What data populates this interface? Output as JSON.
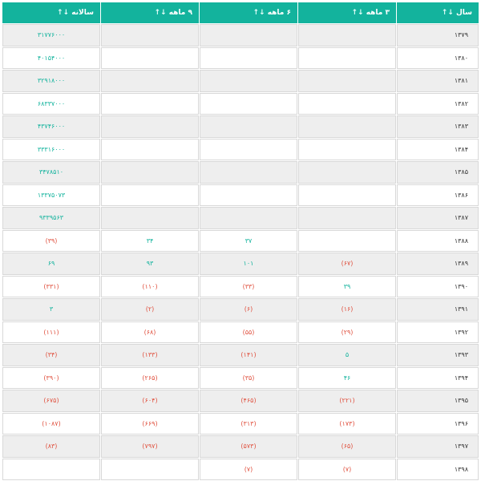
{
  "headers": {
    "year": "سال",
    "q3": "۳ ماهه",
    "q6": "۶ ماهه",
    "q9": "۹ ماهه",
    "annual": "سالانه"
  },
  "sort_icon": "↓↑",
  "colors": {
    "header": "#13b39d",
    "positive": "#13b39d",
    "negative": "#e0513f"
  },
  "rows": [
    {
      "year": "۱۳۷۹",
      "q3": "",
      "q6": "",
      "q9": "",
      "annual": "۳۱۷۷۶۰۰۰"
    },
    {
      "year": "۱۳۸۰",
      "q3": "",
      "q6": "",
      "q9": "",
      "annual": "۴۰۱۵۴۰۰۰"
    },
    {
      "year": "۱۳۸۱",
      "q3": "",
      "q6": "",
      "q9": "",
      "annual": "۳۲۹۱۸۰۰۰"
    },
    {
      "year": "۱۳۸۲",
      "q3": "",
      "q6": "",
      "q9": "",
      "annual": "۶۸۳۳۷۰۰۰"
    },
    {
      "year": "۱۳۸۳",
      "q3": "",
      "q6": "",
      "q9": "",
      "annual": "۴۳۷۴۶۰۰۰"
    },
    {
      "year": "۱۳۸۴",
      "q3": "",
      "q6": "",
      "q9": "",
      "annual": "۳۳۳۱۶۰۰۰"
    },
    {
      "year": "۱۳۸۵",
      "q3": "",
      "q6": "",
      "q9": "",
      "annual": "۳۴۷۸۵۱۰"
    },
    {
      "year": "۱۳۸۶",
      "q3": "",
      "q6": "",
      "q9": "",
      "annual": "۱۳۳۷۵۰۷۳"
    },
    {
      "year": "۱۳۸۷",
      "q3": "",
      "q6": "",
      "q9": "",
      "annual": "۹۳۳۹۵۶۳"
    },
    {
      "year": "۱۳۸۸",
      "q3": "",
      "q6": "۳۷",
      "q9": "۳۴",
      "annual": "(۳۹)"
    },
    {
      "year": "۱۳۸۹",
      "q3": "(۶۷)",
      "q6": "۱۰۱",
      "q9": "۹۳",
      "annual": "۶۹"
    },
    {
      "year": "۱۳۹۰",
      "q3": "۳۹",
      "q6": "(۳۳)",
      "q9": "(۱۱۰)",
      "annual": "(۳۳۱)"
    },
    {
      "year": "۱۳۹۱",
      "q3": "(۱۶)",
      "q6": "(۶)",
      "q9": "(۲)",
      "annual": "۳"
    },
    {
      "year": "۱۳۹۲",
      "q3": "(۲۹)",
      "q6": "(۵۵)",
      "q9": "(۶۸)",
      "annual": "(۱۱۱)"
    },
    {
      "year": "۱۳۹۳",
      "q3": "۵",
      "q6": "(۱۴۱)",
      "q9": "(۱۳۳)",
      "annual": "(۳۴)"
    },
    {
      "year": "۱۳۹۴",
      "q3": "۴۶",
      "q6": "(۳۵)",
      "q9": "(۲۶۵)",
      "annual": "(۳۹۰)"
    },
    {
      "year": "۱۳۹۵",
      "q3": "(۲۲۱)",
      "q6": "(۴۶۵)",
      "q9": "(۶۰۴)",
      "annual": "(۶۷۵)"
    },
    {
      "year": "۱۳۹۶",
      "q3": "(۱۷۳)",
      "q6": "(۳۱۳)",
      "q9": "(۶۶۹)",
      "annual": "(۱۰۸۷)"
    },
    {
      "year": "۱۳۹۷",
      "q3": "(۶۵)",
      "q6": "(۵۷۳)",
      "q9": "(۷۹۷)",
      "annual": "(۸۳)"
    },
    {
      "year": "۱۳۹۸",
      "q3": "(۷)",
      "q6": "(۷)",
      "q9": "",
      "annual": ""
    }
  ]
}
